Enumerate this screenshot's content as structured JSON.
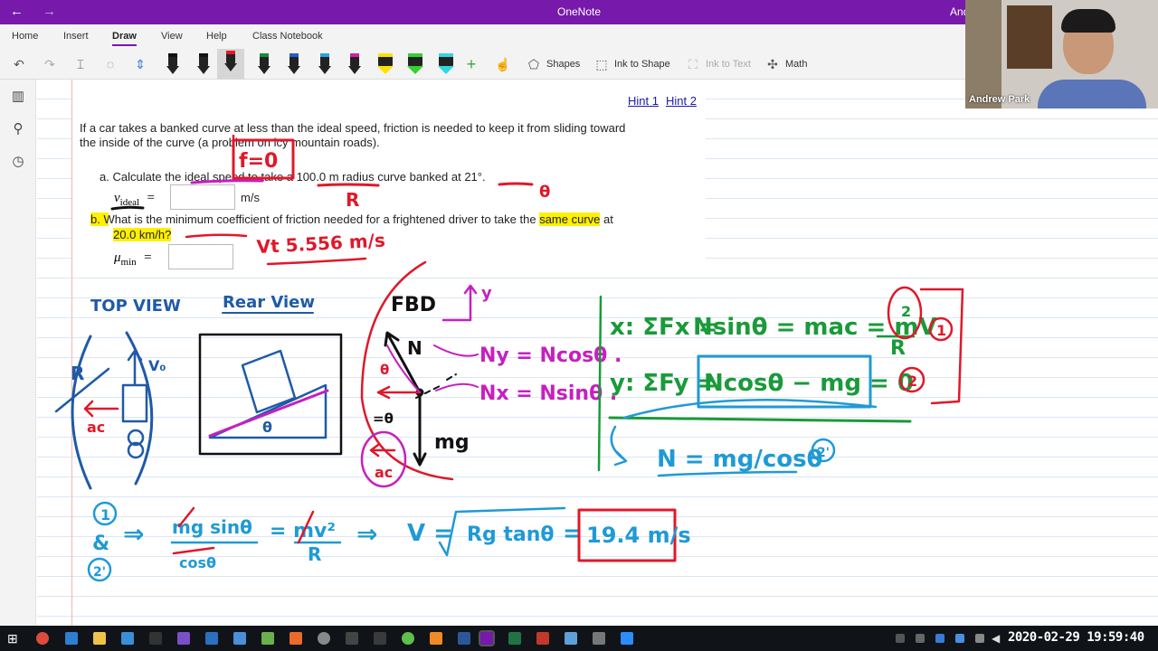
{
  "window": {
    "title": "OneNote",
    "user_abbrev": "And",
    "back": "←",
    "forward": "→"
  },
  "ribbon": {
    "tabs": [
      {
        "label": "Home"
      },
      {
        "label": "Insert"
      },
      {
        "label": "Draw",
        "active": true
      },
      {
        "label": "View"
      },
      {
        "label": "Help"
      },
      {
        "label": "Class Notebook"
      }
    ]
  },
  "toolbar": {
    "shapes_label": "Shapes",
    "ink_to_shape_label": "Ink to Shape",
    "ink_to_text_label": "Ink to Text",
    "math_label": "Math",
    "pen_colors": [
      "#111111",
      "#111111",
      "#e8182a",
      "#0f8f3a",
      "#1f5fd6",
      "#27a3e0",
      "#d01fa8",
      "#ffe000",
      "#33d133",
      "#2fd8e0"
    ],
    "selected_pen_index": 2
  },
  "page": {
    "hint1": "Hint 1",
    "hint2": "Hint 2",
    "intro_line1": "If a car takes a banked curve at less than the ideal speed, friction is needed to keep it from sliding toward",
    "intro_line2": "the inside of the curve (a problem on icy mountain roads).",
    "part_a_prefix": "a. Calculate the ideal speed to take a",
    "part_a_radius": "100.0 m",
    "part_a_middle": "radius curve banked at",
    "part_a_angle": "21°",
    "part_a_end": ".",
    "v_ideal_symbol": "v",
    "v_ideal_sub": "ideal",
    "equals": "=",
    "v_unit": "m/s",
    "part_b_prefix": "b. What is the minimum coefficient of friction needed for a frightened driver to take the",
    "part_b_highlight": "same curve",
    "part_b_at": "at",
    "part_b_speed": "20.0 km/h?",
    "mu_symbol": "μ",
    "mu_sub": "min"
  },
  "ink": {
    "f0": "f=0",
    "R_under": "R",
    "theta_under": "θ",
    "vt": "Vt 5.556 m/s",
    "top_view": "TOP VIEW",
    "rear_view": "Rear View",
    "fbd": "FBD",
    "y_axis": "y",
    "N": "N",
    "mg": "mg",
    "theta_small": "θ",
    "theta_eq": "=θ",
    "ac": "ac",
    "Ny": "Ny = Ncosθ .",
    "Nx": "Nx = Nsinθ .",
    "R_left": "R",
    "v0": "V₀",
    "ac_left": "ac",
    "eq_x": "x: ΣFx = Nsinθ = mac = mv²/R",
    "eq_x_prefix": "x: ΣFx =",
    "eq_x_mid": "Nsinθ = mac = mV",
    "eq_x_exp": "2",
    "eq_x_R": "R",
    "eq_y_prefix": "y: ΣFy =",
    "eq_y_box": "Ncosθ − mg = 0",
    "circle1": "1",
    "circle2": "2",
    "eq_N": "N = mg/cosθ",
    "eq_N2": "2'",
    "step_1": "1",
    "step_amp": "&",
    "step_2": "2'",
    "combine_arrow": "⇒",
    "combine_lhs": "mg sinθ",
    "combine_lhs_den": "cosθ",
    "combine_rhs": "= mv²",
    "combine_rhs_den": "R",
    "result_arrow": "⇒",
    "result_lhs": "V =",
    "result_root": "Rg tanθ",
    "result_eq": "=",
    "result_value": "19.4 m/s"
  },
  "webcam": {
    "name": "Andrew Park"
  },
  "taskbar": {
    "clock": "2020-02-29 19:59:40"
  }
}
